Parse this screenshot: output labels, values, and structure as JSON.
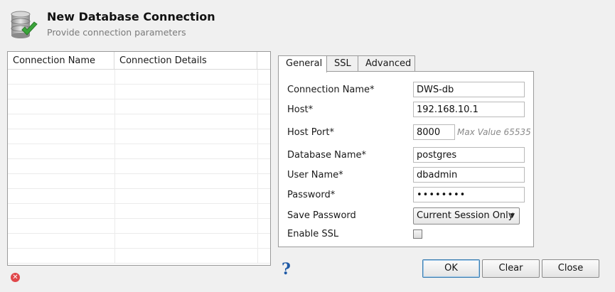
{
  "header": {
    "title": "New Database Connection",
    "subtitle": "Provide connection parameters",
    "icon": "database-check-icon"
  },
  "connection_table": {
    "columns": [
      "Connection Name",
      "Connection Details"
    ],
    "rows": []
  },
  "tabs": [
    {
      "label": "General",
      "active": true
    },
    {
      "label": "SSL",
      "active": false
    },
    {
      "label": "Advanced",
      "active": false
    }
  ],
  "form": {
    "connection_name": {
      "label": "Connection Name*",
      "value": "DWS-db"
    },
    "host": {
      "label": "Host*",
      "value": "192.168.10.1"
    },
    "host_port": {
      "label": "Host Port*",
      "value": "8000",
      "hint": "Max Value 65535"
    },
    "database_name": {
      "label": "Database Name*",
      "value": "postgres"
    },
    "user_name": {
      "label": "User Name*",
      "value": "dbadmin"
    },
    "password": {
      "label": "Password*",
      "value": "••••••••"
    },
    "save_password": {
      "label": "Save Password",
      "selected": "Current Session Only"
    },
    "enable_ssl": {
      "label": "Enable SSL",
      "checked": false
    }
  },
  "buttons": {
    "ok": "OK",
    "clear": "Clear",
    "close": "Close"
  },
  "colors": {
    "accent": "#3c7fb1",
    "error": "#e0474a",
    "help": "#1f5aa6"
  }
}
